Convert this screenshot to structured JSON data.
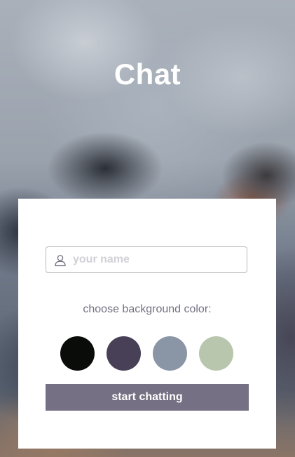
{
  "app": {
    "title": "Chat"
  },
  "form": {
    "name_placeholder": "your name",
    "name_value": "",
    "user_icon": "user-icon",
    "background_label": "choose background color:",
    "colors": [
      {
        "name": "black",
        "hex": "#090C08"
      },
      {
        "name": "purple",
        "hex": "#474056"
      },
      {
        "name": "grey-blue",
        "hex": "#8A95A5"
      },
      {
        "name": "green",
        "hex": "#B9C6AE"
      }
    ],
    "start_label": "start chatting",
    "start_button_color": "#757083"
  }
}
